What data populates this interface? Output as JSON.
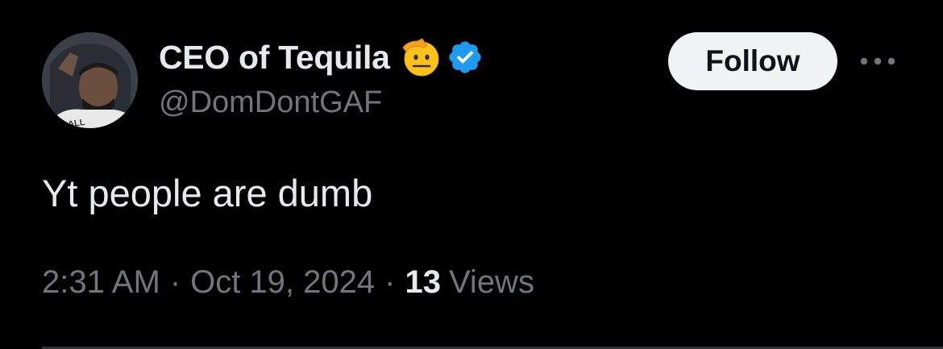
{
  "author": {
    "display_name": "CEO of Tequila",
    "emoji": "saluting-face-emoji",
    "verified": true,
    "handle": "@DomDontGAF",
    "avatar": "profile-photo"
  },
  "follow_button": {
    "label": "Follow"
  },
  "more_button": {
    "icon": "more-icon"
  },
  "tweet": {
    "text": "Yt people are dumb",
    "time": "2:31 AM",
    "separator": "·",
    "date": "Oct 19, 2024",
    "views_count": "13",
    "views_label": "Views"
  },
  "colors": {
    "background": "#000000",
    "primary_text": "#e7e9ea",
    "secondary_text": "#71767b",
    "verified_blue": "#1d9bf0",
    "follow_bg": "#eff3f4",
    "divider": "#2f3336"
  }
}
